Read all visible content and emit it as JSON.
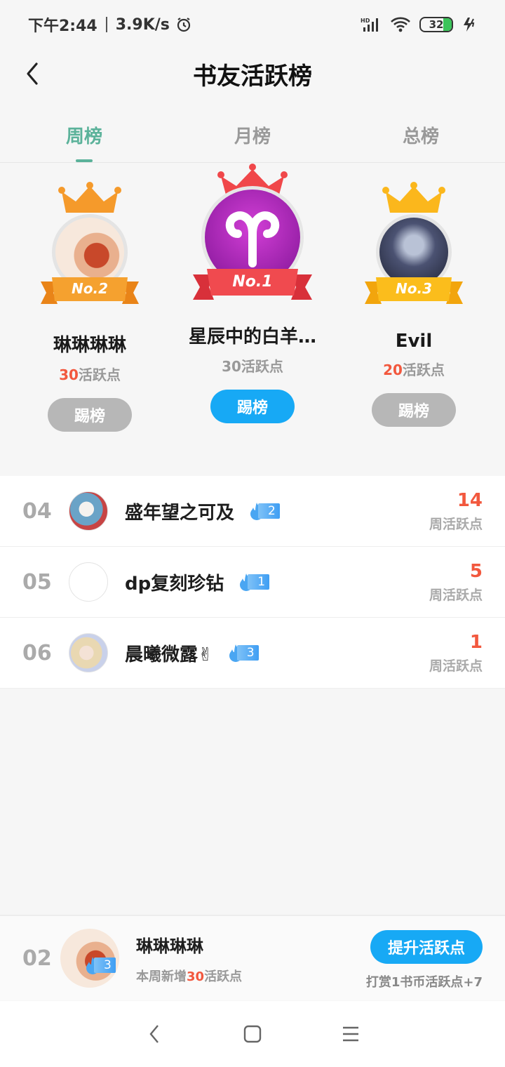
{
  "status": {
    "time": "下午2:44",
    "speed": "3.9K/s",
    "battery": "32"
  },
  "header": {
    "title": "书友活跃榜"
  },
  "tabs": [
    {
      "label": "周榜",
      "active": true
    },
    {
      "label": "月榜",
      "active": false
    },
    {
      "label": "总榜",
      "active": false
    }
  ],
  "podium": {
    "first": {
      "badge": "No.1",
      "name": "星辰中的白羊…",
      "points": "30",
      "points_suffix": "活跃点",
      "button": "踢榜"
    },
    "second": {
      "badge": "No.2",
      "name": "琳琳琳琳",
      "points": "30",
      "points_suffix": "活跃点",
      "button": "踢榜"
    },
    "third": {
      "badge": "No.3",
      "name": "Evil",
      "points": "20",
      "points_suffix": "活跃点",
      "button": "踢榜"
    }
  },
  "list": [
    {
      "rank": "04",
      "name": "盛年望之可及",
      "fire_level": "2",
      "score": "14",
      "score_label": "周活跃点"
    },
    {
      "rank": "05",
      "name": "dp复刻珍钻",
      "fire_level": "1",
      "score": "5",
      "score_label": "周活跃点"
    },
    {
      "rank": "06",
      "name": "晨曦微露✌",
      "fire_level": "3",
      "score": "1",
      "score_label": "周活跃点"
    }
  ],
  "me": {
    "rank": "02",
    "name": "琳琳琳琳",
    "fire_level": "3",
    "sub_prefix": "本周新增",
    "sub_num": "30",
    "sub_suffix": "活跃点",
    "boost_button": "提升活跃点",
    "hint": "打赏1书币活跃点+7"
  },
  "colors": {
    "accent": "#5bb29a",
    "primary_button": "#17a9f5",
    "score_red": "#f2583e"
  }
}
